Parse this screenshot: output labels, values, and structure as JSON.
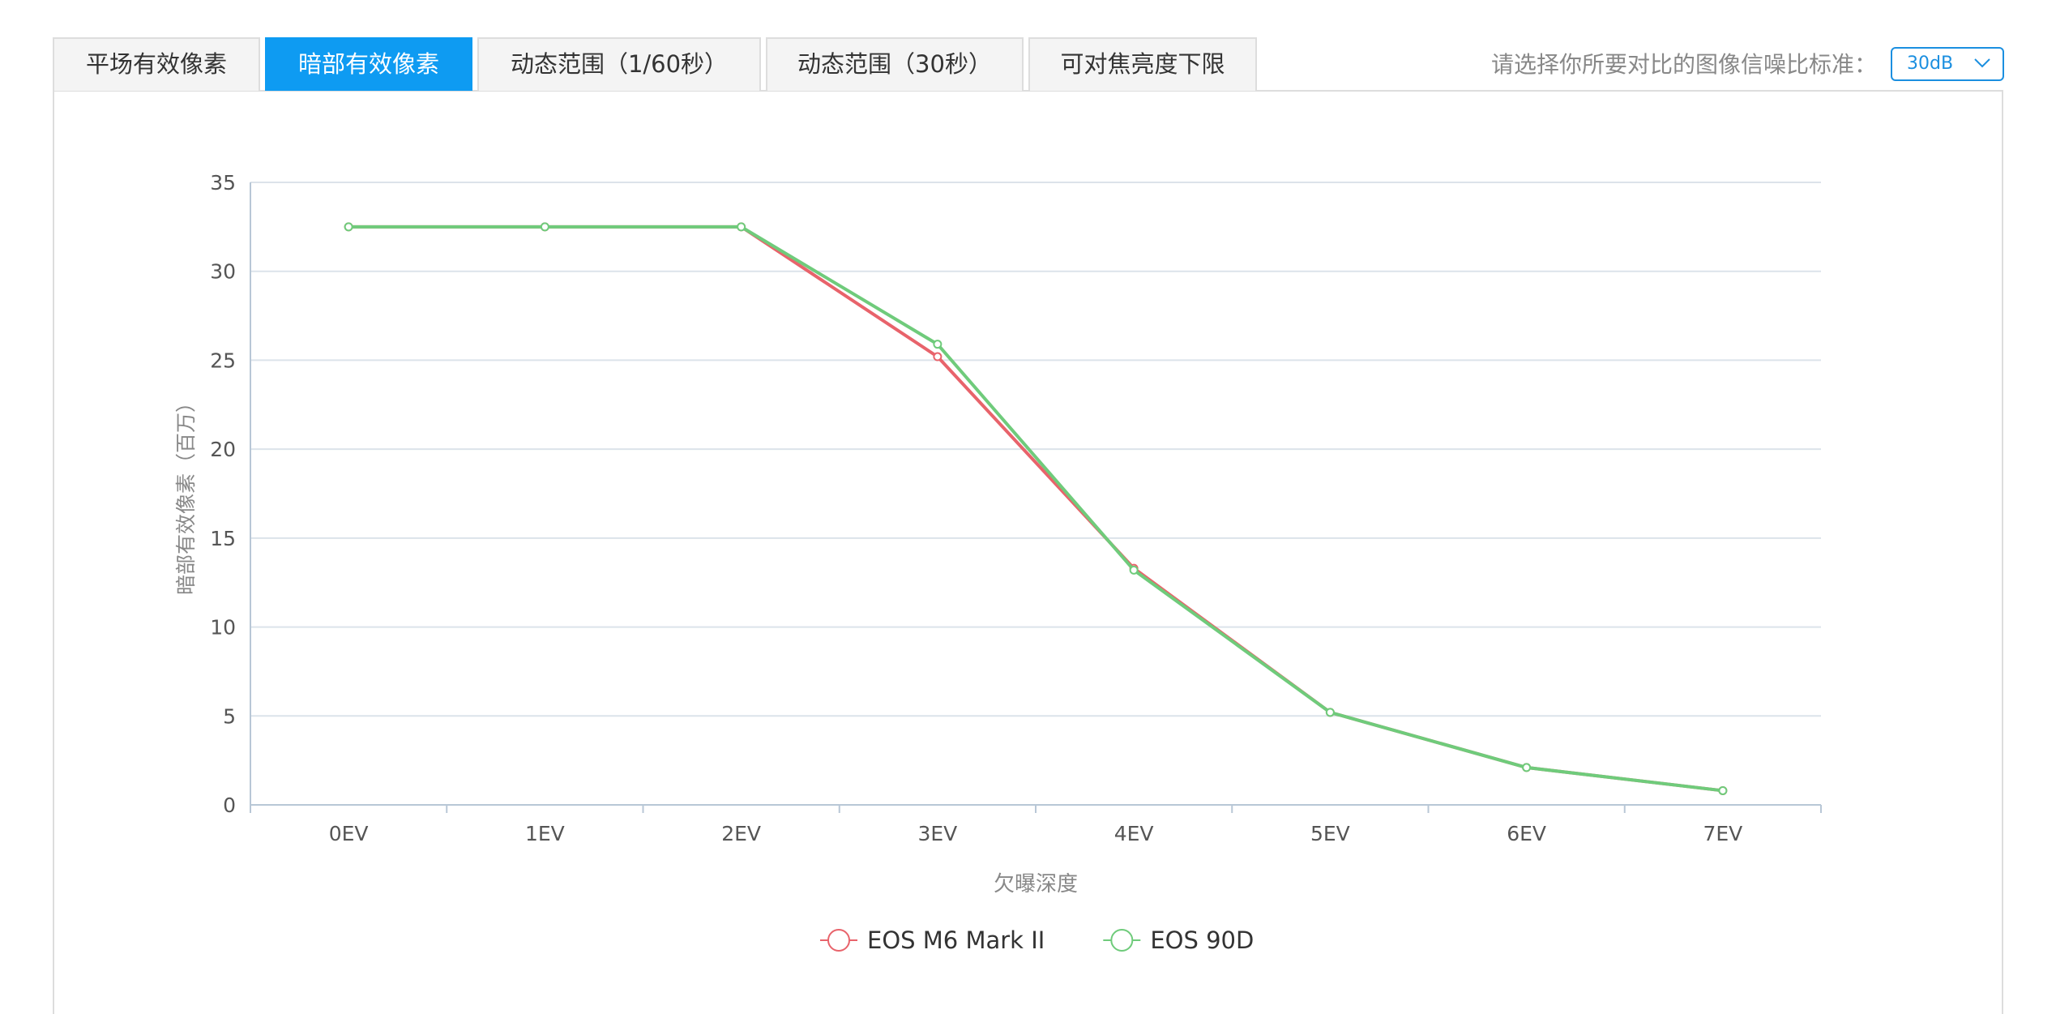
{
  "tabs": [
    {
      "label": "平场有效像素",
      "active": false
    },
    {
      "label": "暗部有效像素",
      "active": true
    },
    {
      "label": "动态范围（1/60秒）",
      "active": false
    },
    {
      "label": "动态范围（30秒）",
      "active": false
    },
    {
      "label": "可对焦亮度下限",
      "active": false
    }
  ],
  "selector": {
    "label": "请选择你所要对比的图像信噪比标准：",
    "value": "30dB"
  },
  "chart_data": {
    "type": "line",
    "title": "",
    "xlabel": "欠曝深度",
    "ylabel": "暗部有效像素（百万）",
    "categories": [
      "0EV",
      "1EV",
      "2EV",
      "3EV",
      "4EV",
      "5EV",
      "6EV",
      "7EV"
    ],
    "ylim": [
      0,
      35
    ],
    "yticks": [
      0,
      5,
      10,
      15,
      20,
      25,
      30,
      35
    ],
    "grid": true,
    "legend": "bottom-center",
    "series": [
      {
        "name": "EOS M6 Mark II",
        "color": "#e8636b",
        "values": [
          32.5,
          32.5,
          32.5,
          25.2,
          13.3,
          5.2,
          2.1,
          0.8
        ]
      },
      {
        "name": "EOS 90D",
        "color": "#6fcb7b",
        "values": [
          32.5,
          32.5,
          32.5,
          25.9,
          13.2,
          5.2,
          2.1,
          0.8
        ]
      }
    ]
  }
}
